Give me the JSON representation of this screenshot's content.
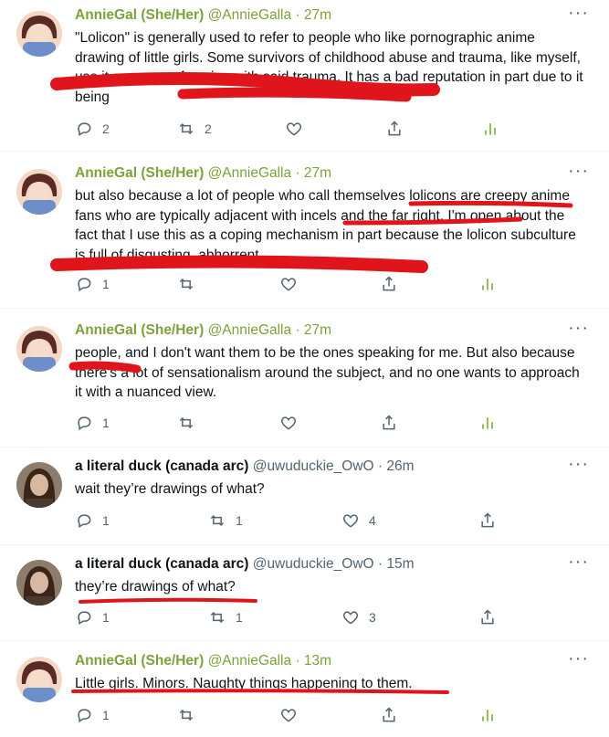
{
  "tweets": [
    {
      "name": "AnnieGal (She/Her)",
      "handle": "@AnnieGalla",
      "dot": "·",
      "time": "27m",
      "text": "\"Lolicon\" is generally used to refer to people who like pornographic anime drawing of little girls. Some survivors of childhood abuse and trauma, like myself, use it as a way of coping with said trauma. It has a bad reputation in part due to it being",
      "replies": "2",
      "retweets": "2",
      "likes": ""
    },
    {
      "name": "AnnieGal (She/Her)",
      "handle": "@AnnieGalla",
      "dot": "·",
      "time": "27m",
      "text": "but also because a lot of people who call themselves lolicons are creepy anime fans who are typically adjacent with incels and the far right. I'm open about the fact that I use this as a coping mechanism in part because the lolicon subculture is full of disgusting, abhorrent",
      "replies": "1",
      "retweets": "",
      "likes": ""
    },
    {
      "name": "AnnieGal (She/Her)",
      "handle": "@AnnieGalla",
      "dot": "·",
      "time": "27m",
      "text": "people, and I don't want them to be the ones speaking for me. But also because there's a lot of sensationalism around the subject, and no one wants to approach it with a nuanced view.",
      "replies": "1",
      "retweets": "",
      "likes": ""
    },
    {
      "name": "a literal duck (canada arc)",
      "handle": "@uwuduckie_OwO",
      "dot": "·",
      "time": "26m",
      "text": "wait they’re drawings of what?",
      "replies": "1",
      "retweets": "1",
      "likes": "4"
    },
    {
      "name": "a literal duck (canada arc)",
      "handle": "@uwuduckie_OwO",
      "dot": "·",
      "time": "15m",
      "text": "they’re drawings of what?",
      "replies": "1",
      "retweets": "1",
      "likes": "3"
    },
    {
      "name": "AnnieGal (She/Her)",
      "handle": "@AnnieGalla",
      "dot": "·",
      "time": "13m",
      "text": "Little girls. Minors. Naughty things happening to them.",
      "replies": "1",
      "retweets": "",
      "likes": ""
    }
  ],
  "icons": {
    "reply": "reply-icon",
    "retweet": "retweet-icon",
    "like": "heart-icon",
    "share": "share-icon",
    "analytics": "analytics-icon",
    "more": "more-icon"
  },
  "colors": {
    "annie_name": "#7fa13b",
    "analytics": "#7fb13b",
    "scribble": "#e0141b",
    "secondary": "#536471"
  }
}
